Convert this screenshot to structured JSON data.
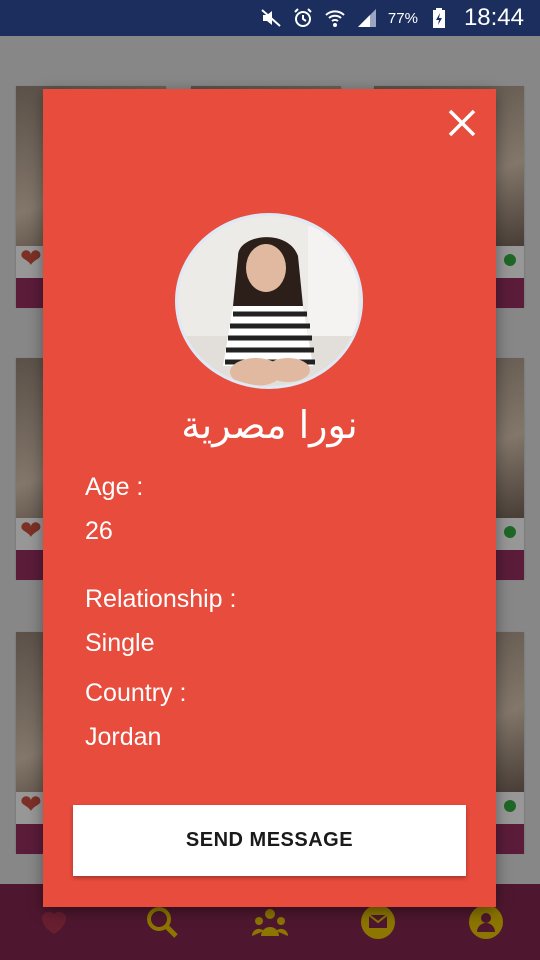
{
  "status_bar": {
    "battery_percent": "77%",
    "time": "18:44",
    "icons": [
      "mute-icon",
      "alarm-icon",
      "wifi-icon",
      "signal-icon",
      "battery-icon"
    ]
  },
  "colors": {
    "dialog_background": "#e84c3d",
    "status_bar": "#1b2e5e",
    "bottom_nav": "#7a2449",
    "accent_icon": "#d8b400"
  },
  "profile_dialog": {
    "close_icon": "close-icon",
    "name": "نورا مصرية",
    "fields": [
      {
        "label": "Age :",
        "value": "26"
      },
      {
        "label": "Relationship :",
        "value": "Single"
      },
      {
        "label": "Country :",
        "value": "Jordan"
      }
    ],
    "send_button_label": "SEND MESSAGE"
  },
  "bottom_nav": {
    "items": [
      "home-icon",
      "search-icon",
      "group-icon",
      "mail-icon",
      "profile-icon"
    ]
  }
}
